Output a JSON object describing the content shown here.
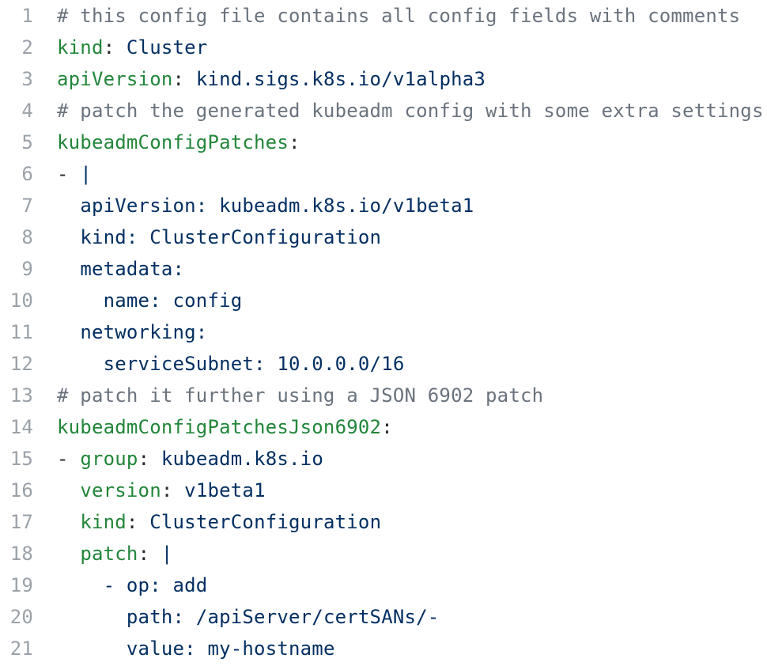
{
  "colors": {
    "background": "#ffffff",
    "line_number": "#9aa1a8",
    "comment": "#6a737d",
    "key": "#22863a",
    "punctuation": "#24292e",
    "string": "#032f62"
  },
  "lines": [
    {
      "number": "1",
      "indent": "",
      "tokens": [
        {
          "type": "comment",
          "text": "# this config file contains all config fields with comments"
        }
      ]
    },
    {
      "number": "2",
      "indent": "",
      "tokens": [
        {
          "type": "key",
          "text": "kind"
        },
        {
          "type": "punct",
          "text": ": "
        },
        {
          "type": "value",
          "text": "Cluster"
        }
      ]
    },
    {
      "number": "3",
      "indent": "",
      "tokens": [
        {
          "type": "key",
          "text": "apiVersion"
        },
        {
          "type": "punct",
          "text": ": "
        },
        {
          "type": "value",
          "text": "kind.sigs.k8s.io/v1alpha3"
        }
      ]
    },
    {
      "number": "4",
      "indent": "",
      "tokens": [
        {
          "type": "comment",
          "text": "# patch the generated kubeadm config with some extra settings"
        }
      ]
    },
    {
      "number": "5",
      "indent": "",
      "tokens": [
        {
          "type": "key",
          "text": "kubeadmConfigPatches"
        },
        {
          "type": "punct",
          "text": ":"
        }
      ]
    },
    {
      "number": "6",
      "indent": "",
      "tokens": [
        {
          "type": "punct",
          "text": "- "
        },
        {
          "type": "value",
          "text": "|"
        }
      ]
    },
    {
      "number": "7",
      "indent": "  ",
      "tokens": [
        {
          "type": "value",
          "text": "apiVersion: kubeadm.k8s.io/v1beta1"
        }
      ]
    },
    {
      "number": "8",
      "indent": "  ",
      "tokens": [
        {
          "type": "value",
          "text": "kind: ClusterConfiguration"
        }
      ]
    },
    {
      "number": "9",
      "indent": "  ",
      "tokens": [
        {
          "type": "value",
          "text": "metadata:"
        }
      ]
    },
    {
      "number": "10",
      "indent": "    ",
      "tokens": [
        {
          "type": "value",
          "text": "name: config"
        }
      ]
    },
    {
      "number": "11",
      "indent": "  ",
      "tokens": [
        {
          "type": "value",
          "text": "networking:"
        }
      ]
    },
    {
      "number": "12",
      "indent": "    ",
      "tokens": [
        {
          "type": "value",
          "text": "serviceSubnet: 10.0.0.0/16"
        }
      ]
    },
    {
      "number": "13",
      "indent": "",
      "tokens": [
        {
          "type": "comment",
          "text": "# patch it further using a JSON 6902 patch"
        }
      ]
    },
    {
      "number": "14",
      "indent": "",
      "tokens": [
        {
          "type": "key",
          "text": "kubeadmConfigPatchesJson6902"
        },
        {
          "type": "punct",
          "text": ":"
        }
      ]
    },
    {
      "number": "15",
      "indent": "",
      "tokens": [
        {
          "type": "punct",
          "text": "- "
        },
        {
          "type": "key",
          "text": "group"
        },
        {
          "type": "punct",
          "text": ": "
        },
        {
          "type": "value",
          "text": "kubeadm.k8s.io"
        }
      ]
    },
    {
      "number": "16",
      "indent": "  ",
      "tokens": [
        {
          "type": "key",
          "text": "version"
        },
        {
          "type": "punct",
          "text": ": "
        },
        {
          "type": "value",
          "text": "v1beta1"
        }
      ]
    },
    {
      "number": "17",
      "indent": "  ",
      "tokens": [
        {
          "type": "key",
          "text": "kind"
        },
        {
          "type": "punct",
          "text": ": "
        },
        {
          "type": "value",
          "text": "ClusterConfiguration"
        }
      ]
    },
    {
      "number": "18",
      "indent": "  ",
      "tokens": [
        {
          "type": "key",
          "text": "patch"
        },
        {
          "type": "punct",
          "text": ": "
        },
        {
          "type": "value",
          "text": "|"
        }
      ]
    },
    {
      "number": "19",
      "indent": "    ",
      "tokens": [
        {
          "type": "value",
          "text": "- op: add"
        }
      ]
    },
    {
      "number": "20",
      "indent": "      ",
      "tokens": [
        {
          "type": "value",
          "text": "path: /apiServer/certSANs/-"
        }
      ]
    },
    {
      "number": "21",
      "indent": "      ",
      "tokens": [
        {
          "type": "value",
          "text": "value: my-hostname"
        }
      ]
    }
  ]
}
